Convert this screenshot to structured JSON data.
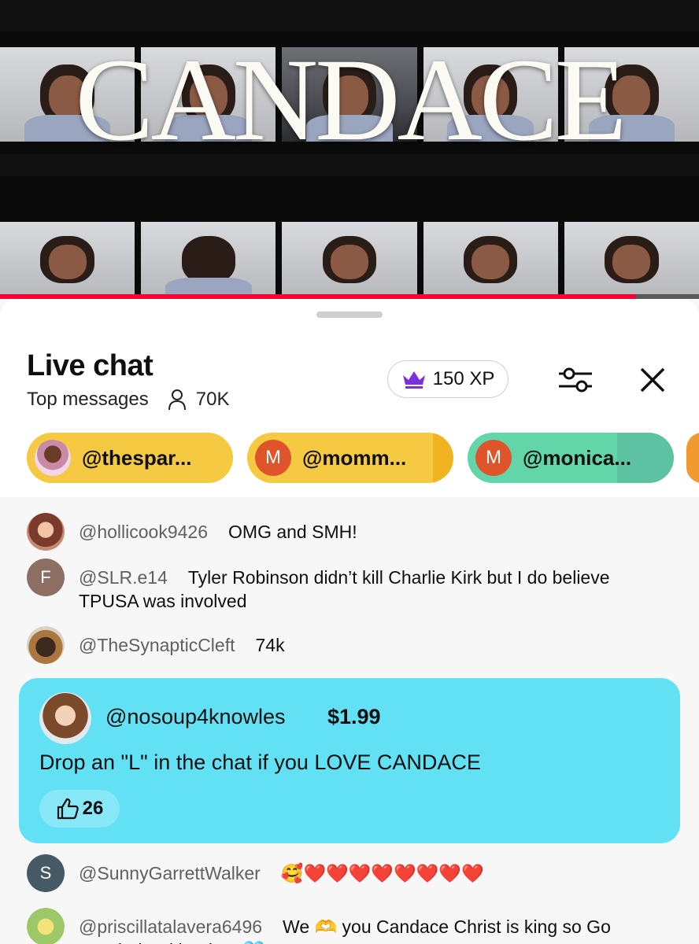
{
  "video": {
    "title_word": "CANDACE",
    "progress_fraction": 0.91
  },
  "chat": {
    "title": "Live chat",
    "mode": "Top messages",
    "viewers": "70K",
    "xp": "150 XP",
    "icons": [
      "crown-icon",
      "person-icon",
      "filter-sliders-icon",
      "close-icon",
      "like-icon"
    ]
  },
  "pinned": [
    {
      "handle": "@thespar...",
      "avatar_letter": ""
    },
    {
      "handle": "@momm...",
      "avatar_letter": "M"
    },
    {
      "handle": "@monica...",
      "avatar_letter": "M"
    }
  ],
  "messages": [
    {
      "author": "@hollicook9426",
      "text": "OMG and SMH!",
      "avatar_letter": ""
    },
    {
      "author": "@SLR.e14",
      "text": "Tyler Robinson didn’t kill Charlie Kirk but I do believe TPUSA was involved",
      "avatar_letter": "F"
    },
    {
      "author": "@TheSynapticCleft",
      "text": "74k",
      "avatar_letter": ""
    }
  ],
  "superchat": {
    "author": "@nosoup4knowles",
    "amount": "$1.99",
    "text": "Drop an \"L\" in the chat if you LOVE CANDACE",
    "likes": "26",
    "color": "#62e1f5"
  },
  "messages_after": [
    {
      "author": "@SunnyGarrettWalker",
      "text": "🥰❤️❤️❤️❤️❤️❤️❤️❤️",
      "avatar_letter": "S"
    },
    {
      "author": "@priscillatalavera6496",
      "text": "We 🫶 you Candace Christ is king so Go Max lady with a boy 🩵",
      "avatar_letter": ""
    }
  ]
}
